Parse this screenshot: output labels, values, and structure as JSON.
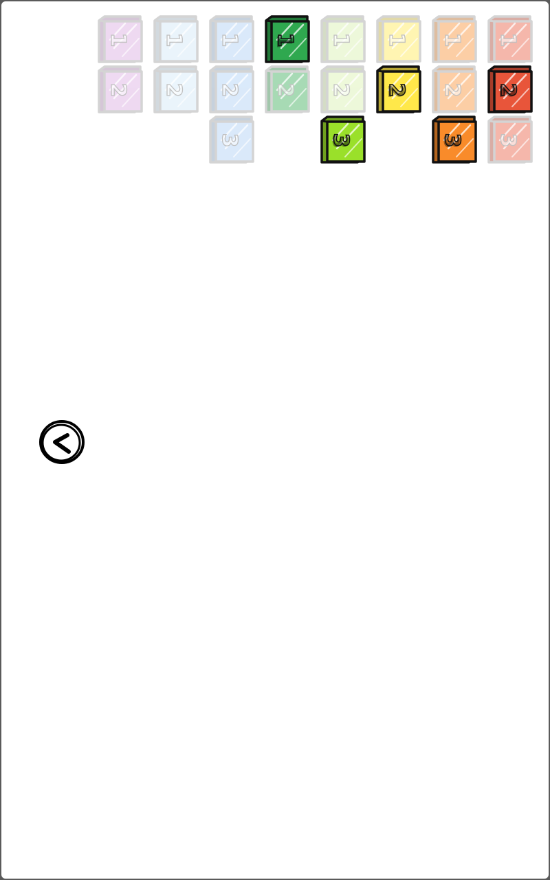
{
  "colors": {
    "background": "#ffffff",
    "outer_border": "#5a5a5a",
    "outline_unlocked": "#111111",
    "outline_locked": "#9a9a9a"
  },
  "back_button": {
    "icon": "back-arrow-icon"
  },
  "level_grid": {
    "columns": [
      {
        "color": "#d9a6e0",
        "levels": [
          {
            "label": "1",
            "unlocked": false
          },
          {
            "label": "2",
            "unlocked": false
          }
        ]
      },
      {
        "color": "#cfe6f7",
        "levels": [
          {
            "label": "1",
            "unlocked": false
          },
          {
            "label": "2",
            "unlocked": false
          }
        ]
      },
      {
        "color": "#a8ccf5",
        "levels": [
          {
            "label": "1",
            "unlocked": false
          },
          {
            "label": "2",
            "unlocked": false
          },
          {
            "label": "3",
            "unlocked": false
          }
        ]
      },
      {
        "color": "#2fa84f",
        "levels": [
          {
            "label": "1",
            "unlocked": true
          },
          {
            "label": "2",
            "unlocked": false
          }
        ]
      },
      {
        "color": "#d6f0a8",
        "levels": [
          {
            "label": "1",
            "unlocked": false
          },
          {
            "label": "2",
            "unlocked": false
          },
          {
            "label": "3",
            "unlocked": true,
            "color": "#9ae02a"
          }
        ]
      },
      {
        "color": "#ffe84a",
        "levels": [
          {
            "label": "1",
            "unlocked": false
          },
          {
            "label": "2",
            "unlocked": true
          }
        ]
      },
      {
        "color": "#f98b2a",
        "levels": [
          {
            "label": "1",
            "unlocked": false
          },
          {
            "label": "2",
            "unlocked": false
          },
          {
            "label": "3",
            "unlocked": true
          }
        ]
      },
      {
        "color": "#e8553a",
        "levels": [
          {
            "label": "1",
            "unlocked": false
          },
          {
            "label": "2",
            "unlocked": true
          },
          {
            "label": "3",
            "unlocked": false
          }
        ]
      }
    ]
  }
}
